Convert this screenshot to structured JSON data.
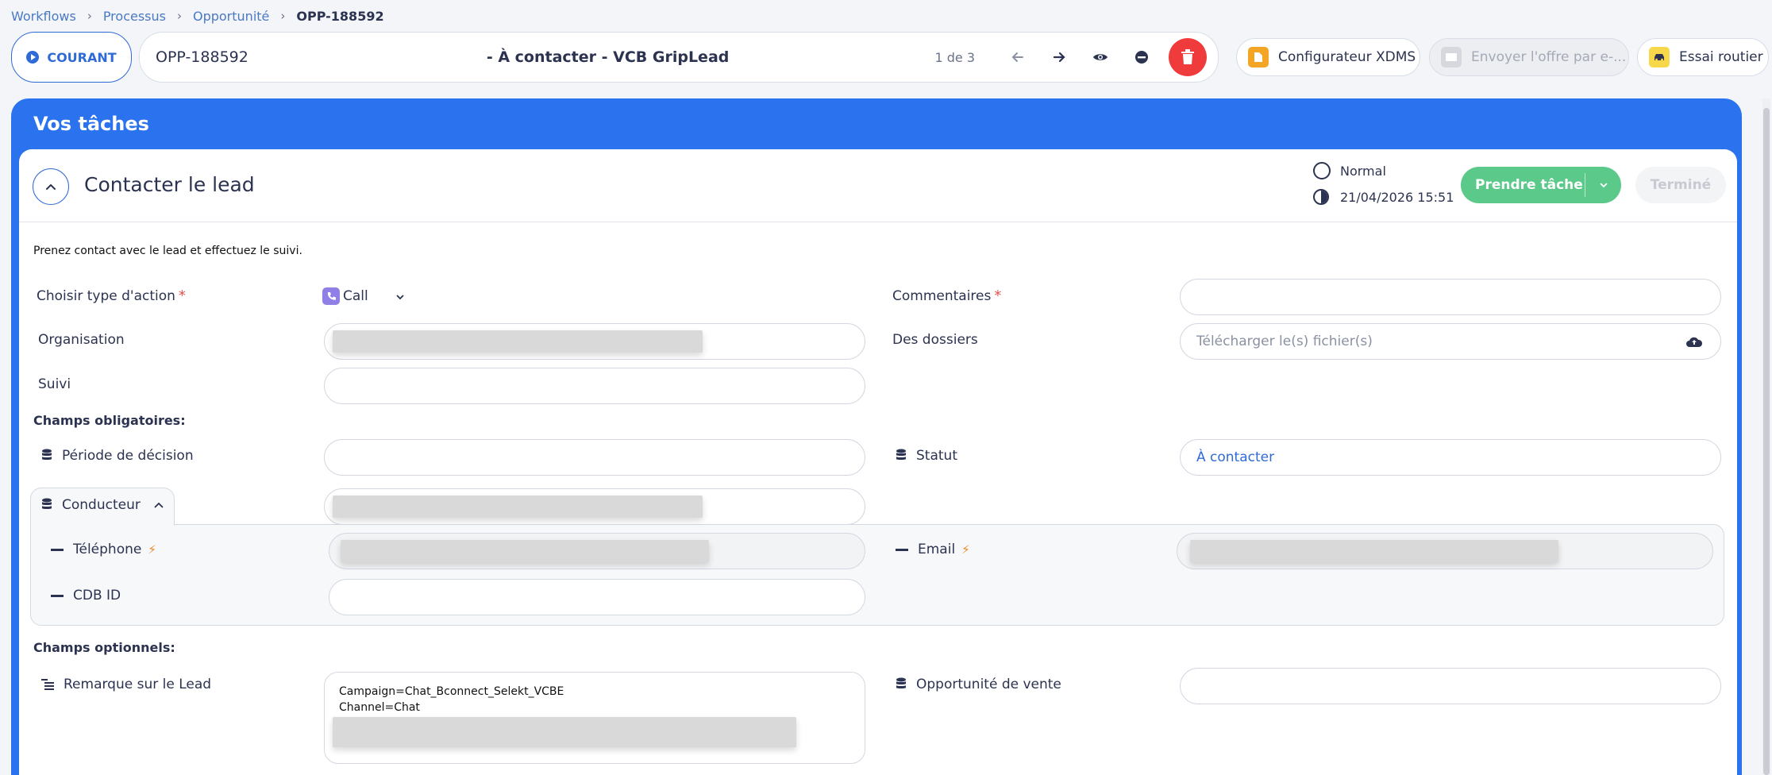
{
  "breadcrumb": [
    "Workflows",
    "Processus",
    "Opportunité",
    "OPP-188592"
  ],
  "topbar": {
    "status_label": "COURANT",
    "record_id": "OPP-188592",
    "record_title": "- À contacter - VCB GripLead",
    "pager": "1 de 3",
    "xdms_label": "Configurateur XDMS",
    "mail_label": "Envoyer l'offre par e-...",
    "essai_label": "Essai routier"
  },
  "panel": {
    "title": "Vos tâches",
    "task_title": "Contacter le lead",
    "priority": "Normal",
    "due": "21/04/2026 15:51",
    "take_label": "Prendre tâche",
    "done_label": "Terminé",
    "description": "Prenez contact avec le lead et effectuez le suivi."
  },
  "form": {
    "action_type_label": "Choisir type d'action",
    "action_type_value": "Call",
    "comments_label": "Commentaires",
    "organisation_label": "Organisation",
    "files_label": "Des dossiers",
    "files_placeholder": "Télécharger le(s) fichier(s)",
    "suivi_label": "Suivi",
    "required_section": "Champs obligatoires:",
    "decision_label": "Période de décision",
    "statut_label": "Statut",
    "statut_value": "À contacter",
    "conducteur_label": "Conducteur",
    "telephone_label": "Téléphone",
    "email_label": "Email",
    "cdb_label": "CDB ID",
    "optional_section": "Champs optionnels:",
    "remark_label": "Remarque sur le Lead",
    "remark_line1": "Campaign=Chat_Bconnect_Selekt_VCBE",
    "remark_line2": "Channel=Chat",
    "opportunity_label": "Opportunité de vente"
  },
  "colors": {
    "primary": "#2b73ee",
    "success": "#5bc98a",
    "danger": "#ef3b3b",
    "required": "#e4504f",
    "bolt": "#f08a24"
  }
}
